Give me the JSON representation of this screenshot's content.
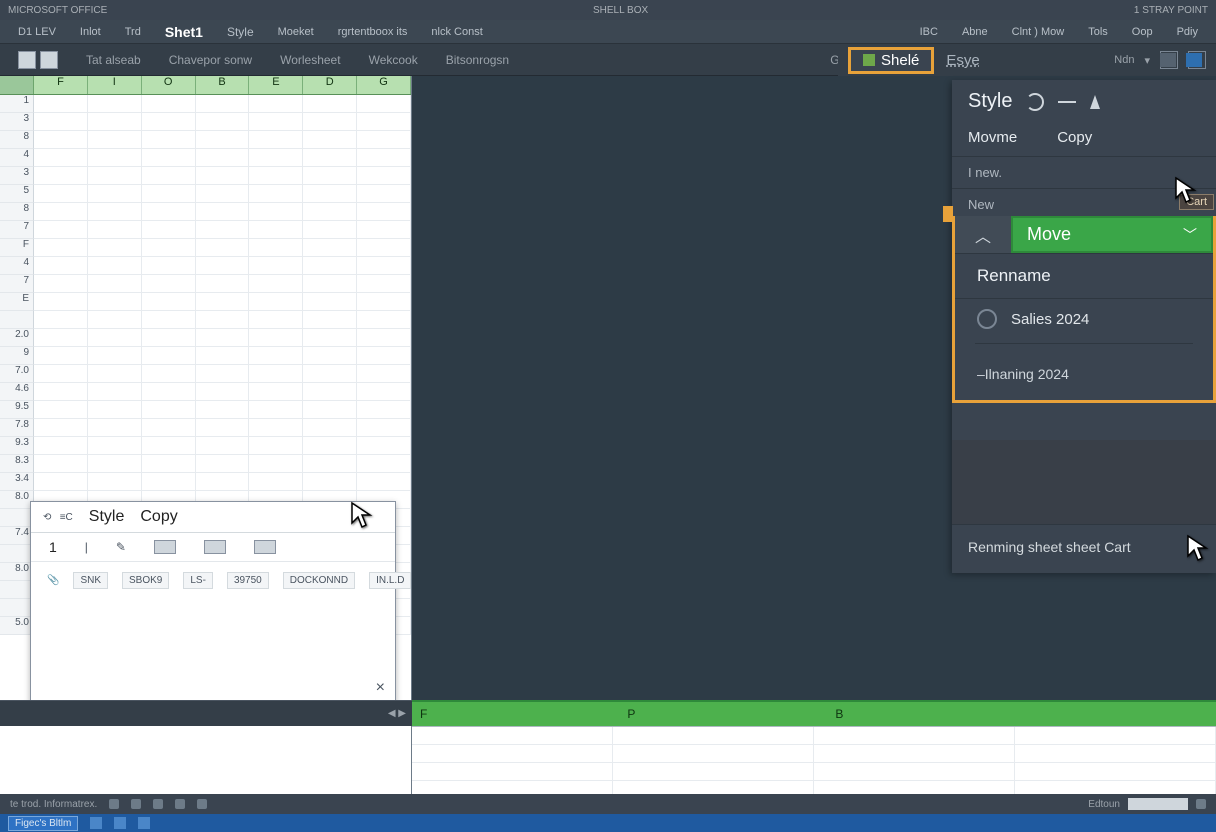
{
  "titlebar": {
    "left": "MICROSOFT OFFICE",
    "center": "SHELL BOX",
    "right": "1 STRAY POINT"
  },
  "menubar": {
    "items_left": [
      "D1 LEV",
      "Inlot",
      "Trd",
      "Shet1",
      "Style",
      "Moeket",
      "rgrtentboox its",
      "nlck Const"
    ],
    "items_right": [
      "IBC",
      "Abne",
      "Clnt ) Mow",
      "Tols",
      "Oop",
      "Pdiy"
    ]
  },
  "toolbar": {
    "items": [
      "",
      "Tat alseab",
      "Chavepor sonw",
      "Worlesheet",
      "Wekcook",
      "Bitsonrogsn"
    ],
    "center": "Gheets.Inseet",
    "right": [
      "Ndn"
    ]
  },
  "sheet_tab": {
    "label": "Shelé",
    "style_link": "Esye"
  },
  "ctx": {
    "title": "Style",
    "movme": "Movme",
    "copy": "Copy",
    "line1": "I new.",
    "line2": "New",
    "cart_badge": "Cart",
    "footer": "Renming sheet  sheet  Cart"
  },
  "dd": {
    "move": "Move",
    "rename": "Rennаme",
    "item1": "Saliеs 2024",
    "item2": "–Ilnaning 2024"
  },
  "grid": {
    "columns": [
      "F",
      "I",
      "O",
      "B",
      "E",
      "D",
      "G"
    ],
    "row_headers": [
      "1",
      "3",
      "8",
      "4",
      "3",
      "5",
      "8",
      "7",
      "F",
      "4",
      "7",
      "E",
      "",
      "2.0",
      "9",
      "7.0",
      "4.6",
      "9.5",
      "7.8",
      "9.3",
      "8.3",
      "3.4",
      "8.0",
      "",
      "7.4",
      "",
      "8.0",
      "",
      "",
      "5.0"
    ]
  },
  "bottom_grid": {
    "columns": [
      "F",
      "P",
      "B"
    ]
  },
  "props": {
    "tabs": [
      "Style",
      "Copy"
    ],
    "num": "1",
    "data": [
      "SNK",
      "SBOK9",
      "LS-",
      "39750",
      "DOCKONND",
      "IN.L.D"
    ],
    "close": "×"
  },
  "statusbar": {
    "left": "te trod. Informatrex.",
    "right_label": "Edtoun"
  },
  "taskbar": {
    "start": "Figec's Bltlm"
  }
}
